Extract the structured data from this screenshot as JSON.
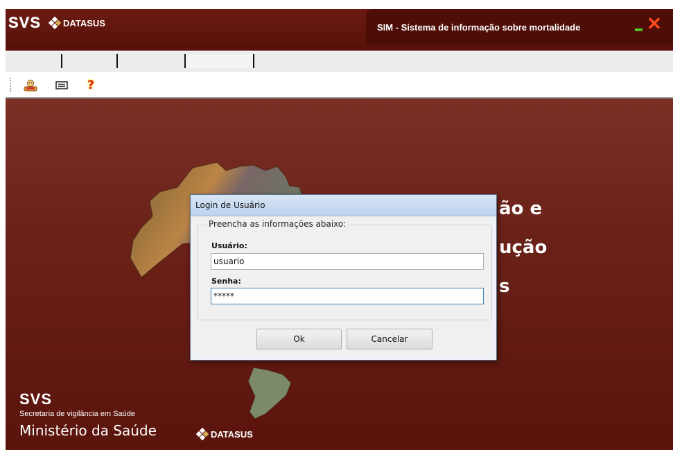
{
  "window": {
    "brand_svs": "SVS",
    "brand_datasus": "DATASUS",
    "title": "SIM - Sistema de informação sobre mortalidade",
    "minimize_icon": "minimize-icon",
    "close_icon": "close-icon",
    "close_glyph": "✕"
  },
  "menu": {
    "tabs": [
      "",
      "",
      "",
      ""
    ]
  },
  "toolbar": {
    "buttons": [
      {
        "icon": "user-people-icon"
      },
      {
        "icon": "card-icon"
      },
      {
        "icon": "help-icon",
        "glyph": "?"
      }
    ]
  },
  "background": {
    "line1": "ão e",
    "line2": "ução",
    "line3": "s",
    "footer_svs": "SVS",
    "footer_secretaria": "Secretaria de vigilância em Saúde",
    "footer_ministerio": "Ministério da Saúde",
    "footer_datasus": "DATASUS"
  },
  "dialog": {
    "title": "Login de Usuário",
    "group_title": "Preencha as informações abaixo:",
    "user_label": "Usuário:",
    "user_value": "usuario",
    "password_label": "Senha:",
    "password_value": "*****",
    "ok_label": "Ok",
    "cancel_label": "Cancelar"
  },
  "colors": {
    "title_bg": "#5a130b",
    "main_bg": "#6a2118",
    "close": "#ff4a1c",
    "minimize": "#55c22a",
    "dialog_title": "#c9dbf0"
  }
}
